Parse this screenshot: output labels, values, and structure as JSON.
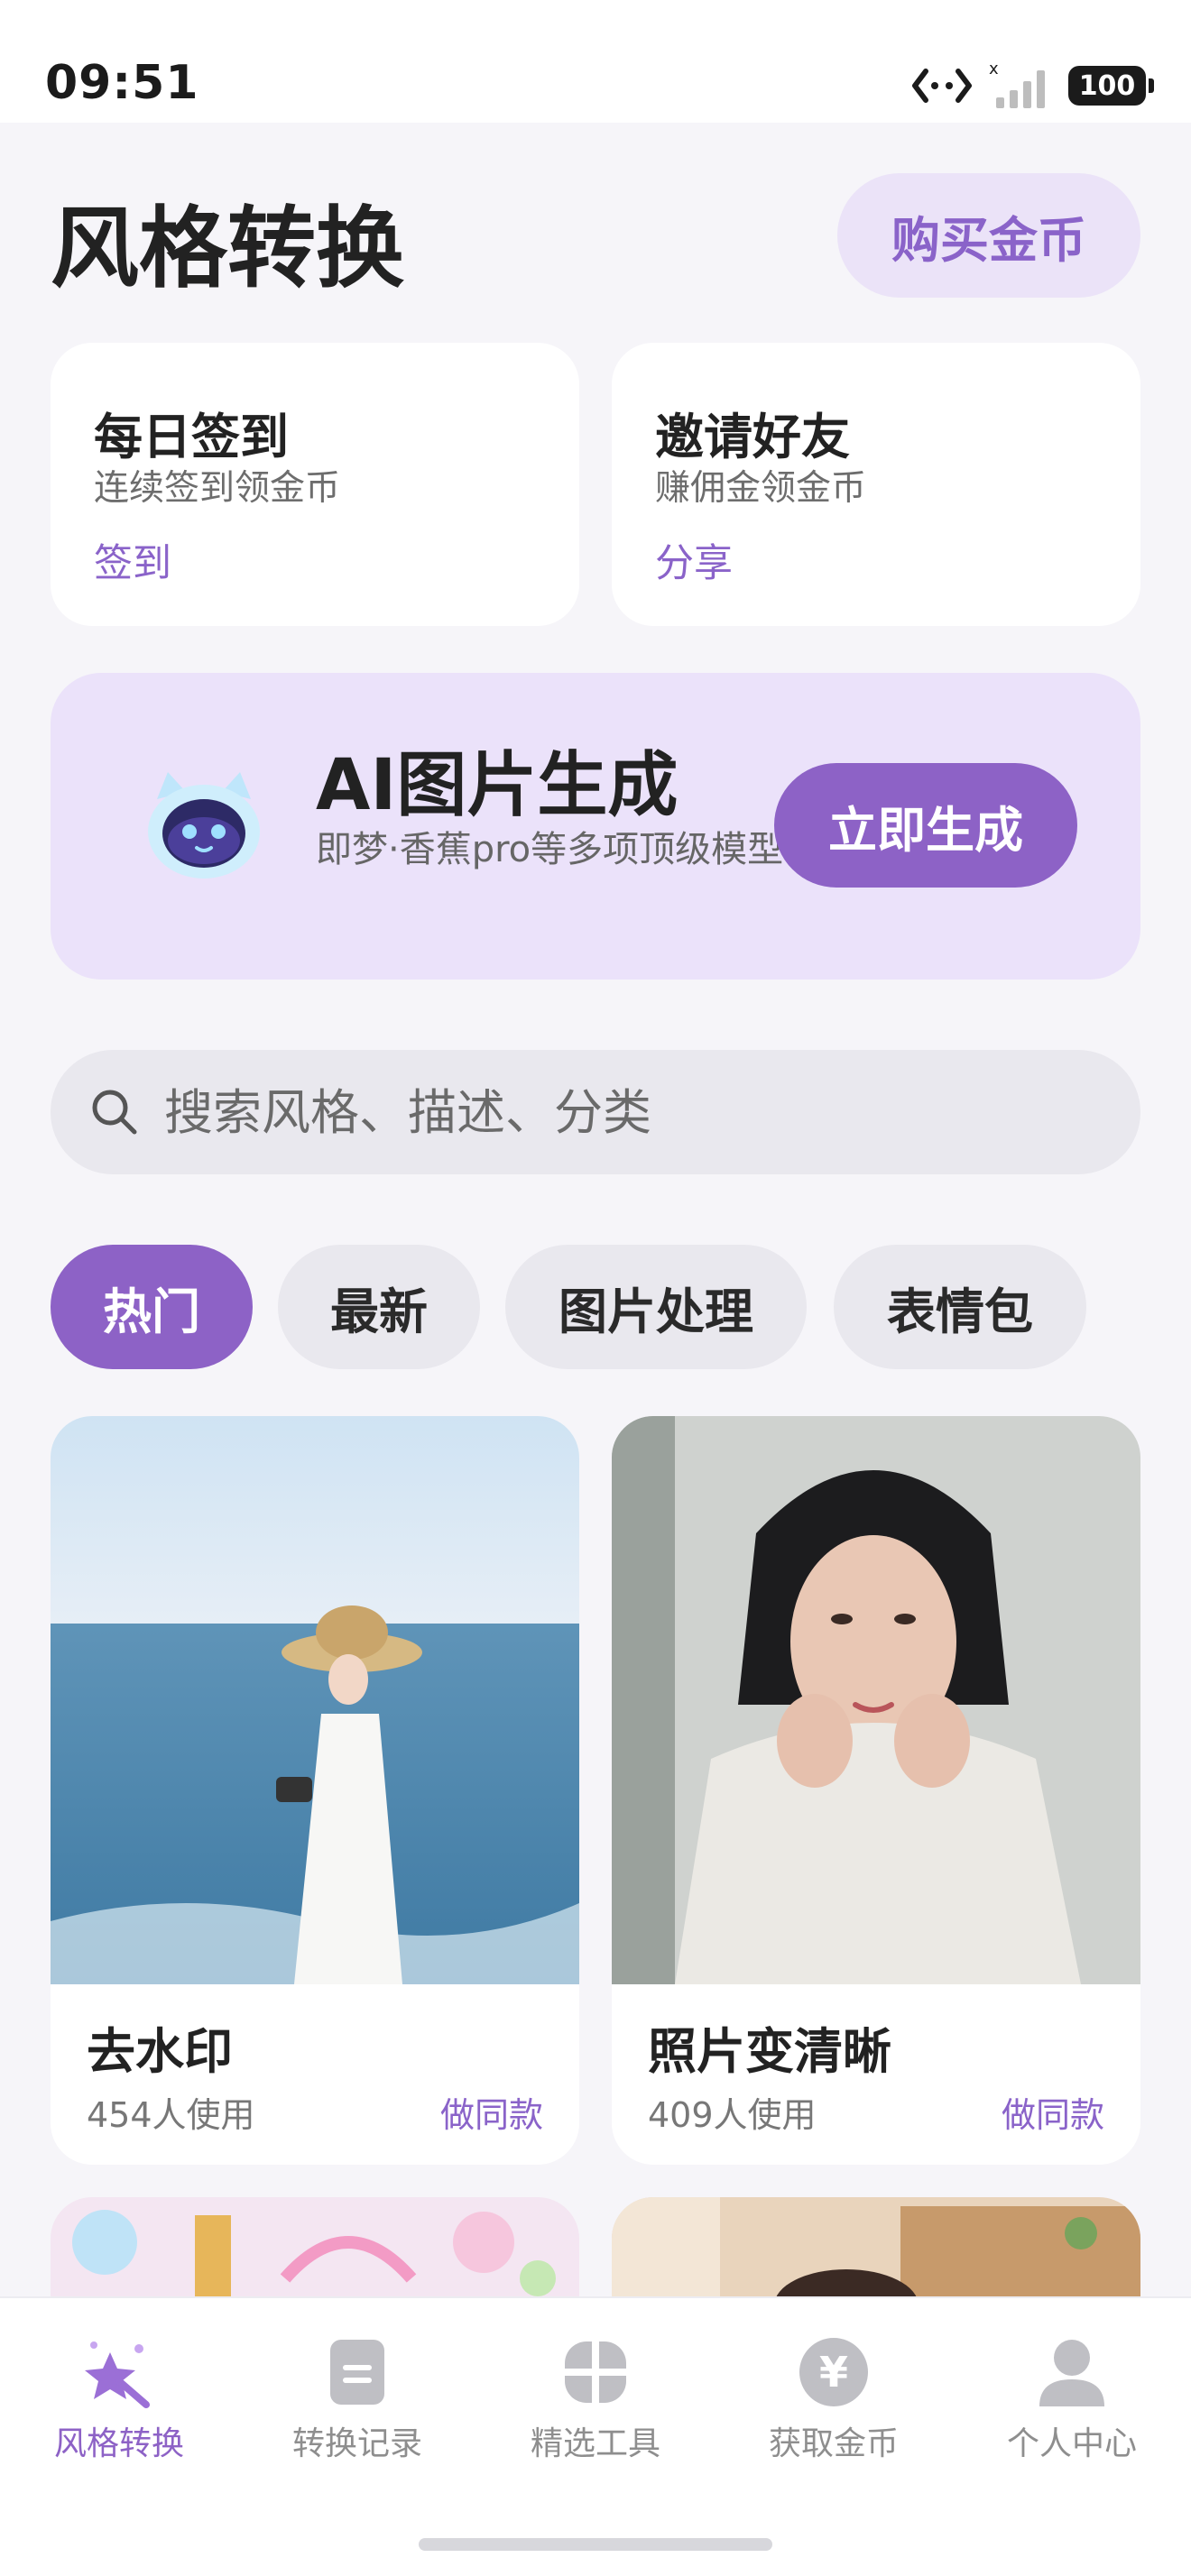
{
  "status": {
    "time": "09:51",
    "battery": "100"
  },
  "header": {
    "title": "风格转换",
    "buy_coins": "购买金币"
  },
  "cards": [
    {
      "title": "每日签到",
      "subtitle": "连续签到领金币",
      "action": "签到"
    },
    {
      "title": "邀请好友",
      "subtitle": "赚佣金领金币",
      "action": "分享"
    }
  ],
  "banner": {
    "title": "AI图片生成",
    "subtitle": "即梦·香蕉pro等多项顶级模型",
    "button": "立即生成"
  },
  "search": {
    "placeholder": "搜索风格、描述、分类"
  },
  "tabs": [
    {
      "label": "热门",
      "active": true
    },
    {
      "label": "最新",
      "active": false
    },
    {
      "label": "图片处理",
      "active": false
    },
    {
      "label": "表情包",
      "active": false
    }
  ],
  "tiles": [
    {
      "title": "去水印",
      "usage": "454人使用",
      "action": "做同款"
    },
    {
      "title": "照片变清晰",
      "usage": "409人使用",
      "action": "做同款"
    }
  ],
  "nav": [
    {
      "label": "风格转换",
      "icon": "magic-star-icon",
      "active": true
    },
    {
      "label": "转换记录",
      "icon": "document-icon",
      "active": false
    },
    {
      "label": "精选工具",
      "icon": "grid-tools-icon",
      "active": false
    },
    {
      "label": "获取金币",
      "icon": "yuan-coin-icon",
      "active": false
    },
    {
      "label": "个人中心",
      "icon": "person-icon",
      "active": false
    }
  ],
  "colors": {
    "accent": "#8d62c6",
    "accent_light": "#ebe2fa",
    "background": "#f6f5f9"
  }
}
